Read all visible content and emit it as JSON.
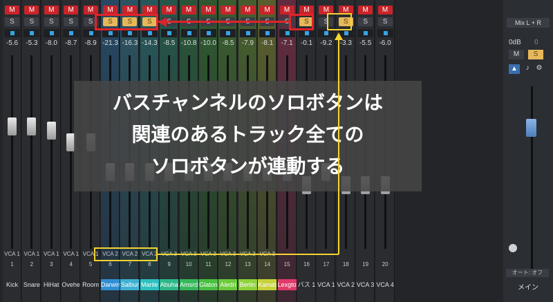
{
  "overlay": {
    "line1": "バスチャンネルのソロボタンは",
    "line2": "関連のあるトラック全ての",
    "line3": "ソロボタンが連動する"
  },
  "strips": [
    {
      "m": "M",
      "s": "S",
      "db": "-5.6",
      "vca": "VCA 1",
      "num": "1",
      "name": "Kick",
      "color": "",
      "solo": false
    },
    {
      "m": "M",
      "s": "S",
      "db": "-5.3",
      "vca": "VCA 1",
      "num": "2",
      "name": "Snare",
      "color": "",
      "solo": false
    },
    {
      "m": "M",
      "s": "S",
      "db": "-8.0",
      "vca": "VCA 1",
      "num": "3",
      "name": "HiHat",
      "color": "",
      "solo": false
    },
    {
      "m": "M",
      "s": "S",
      "db": "-8.7",
      "vca": "VCA 1",
      "num": "4",
      "name": "Ovehe",
      "color": "",
      "solo": false
    },
    {
      "m": "M",
      "s": "S",
      "db": "-8.9",
      "vca": "VCA 1",
      "num": "5",
      "name": "Room",
      "color": "",
      "solo": false
    },
    {
      "m": "M",
      "s": "S",
      "db": "-21.3",
      "vca": "VCA 2",
      "num": "6",
      "name": "Darwin",
      "color": "#2f8fd4",
      "solo": true
    },
    {
      "m": "M",
      "s": "S",
      "db": "-16.3",
      "vca": "VCA 2",
      "num": "7",
      "name": "Salbur",
      "color": "#3db0d4",
      "solo": true
    },
    {
      "m": "M",
      "s": "S",
      "db": "-14.3",
      "vca": "VCA 2",
      "num": "8",
      "name": "Marile",
      "color": "#2dc0c0",
      "solo": true
    },
    {
      "m": "M",
      "s": "S",
      "db": "-8.5",
      "vca": "VCA 3",
      "num": "9",
      "name": "Abuha",
      "color": "#2db88a",
      "solo": false
    },
    {
      "m": "M",
      "s": "S",
      "db": "-10.8",
      "vca": "VCA 3",
      "num": "10",
      "name": "Amsrd",
      "color": "#36b85a",
      "solo": false
    },
    {
      "m": "M",
      "s": "S",
      "db": "-10.0",
      "vca": "VCA 3",
      "num": "11",
      "name": "Glaton",
      "color": "#48c040",
      "solo": false
    },
    {
      "m": "M",
      "s": "S",
      "db": "-8.5",
      "vca": "VCA 3",
      "num": "12",
      "name": "Aledri",
      "color": "#6acc3a",
      "solo": false
    },
    {
      "m": "M",
      "s": "S",
      "db": "-7.9",
      "vca": "VCA 3",
      "num": "13",
      "name": "Berlin",
      "color": "#8ed23a",
      "solo": false
    },
    {
      "m": "M",
      "s": "S",
      "db": "-8.1",
      "vca": "VCA 3",
      "num": "14",
      "name": "Kamati",
      "color": "#c8d23a",
      "solo": false
    },
    {
      "m": "M",
      "s": "S",
      "db": "-7.1",
      "vca": "",
      "num": "15",
      "name": "Lexgto",
      "color": "#e03a6a",
      "solo": false
    },
    {
      "m": "M",
      "s": "S",
      "db": "-0.1",
      "vca": "",
      "num": "16",
      "name": "バス 1",
      "color": "",
      "solo": true
    },
    {
      "m": "M",
      "s": "S",
      "db": "-9.2",
      "vca": "",
      "num": "17",
      "name": "VCA 1",
      "color": "",
      "solo": false
    },
    {
      "m": "M",
      "s": "S",
      "db": "-3.3",
      "vca": "",
      "num": "18",
      "name": "VCA 2",
      "color": "",
      "solo": true
    },
    {
      "m": "M",
      "s": "S",
      "db": "-5.5",
      "vca": "",
      "num": "19",
      "name": "VCA 3",
      "color": "",
      "solo": false
    },
    {
      "m": "M",
      "s": "S",
      "db": "-6.0",
      "vca": "",
      "num": "20",
      "name": "VCA 4",
      "color": "",
      "solo": false
    }
  ],
  "main": {
    "mix": "Mix L + R",
    "db": "0dB",
    "zero": "0",
    "m": "M",
    "s": "S",
    "auto": "オート: オフ",
    "name": "メイン"
  }
}
